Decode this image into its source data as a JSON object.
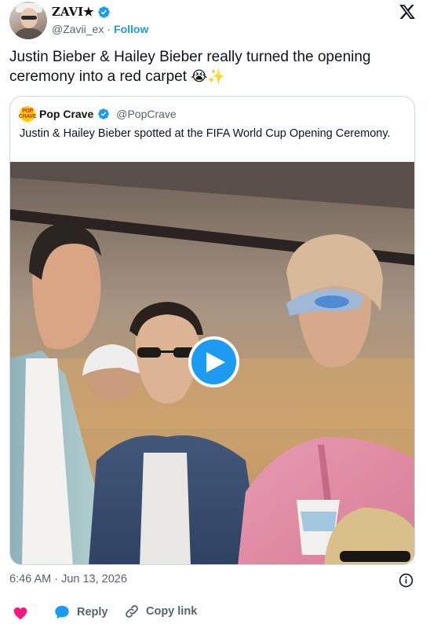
{
  "author": {
    "display_name": "ZAVI★",
    "handle": "@Zavii_ex",
    "separator": "·",
    "follow_label": "Follow"
  },
  "tweet": {
    "text": "Justin Bieber & Hailey Bieber really turned the opening ceremony into a red carpet",
    "emojis": "😭✨"
  },
  "quote": {
    "avatar_text": "POP CRAVE",
    "name": "Pop Crave",
    "handle": "@PopCrave",
    "text": "Justin & Hailey Bieber spotted at the FIFA World Cup Opening Ceremony."
  },
  "meta": {
    "timestamp": "6:46 AM · Jun 13, 2026"
  },
  "actions": {
    "reply_label": "Reply",
    "copy_label": "Copy link"
  },
  "colors": {
    "accent": "#1d9bf0",
    "like": "#f91880",
    "secondary_text": "#536471"
  }
}
